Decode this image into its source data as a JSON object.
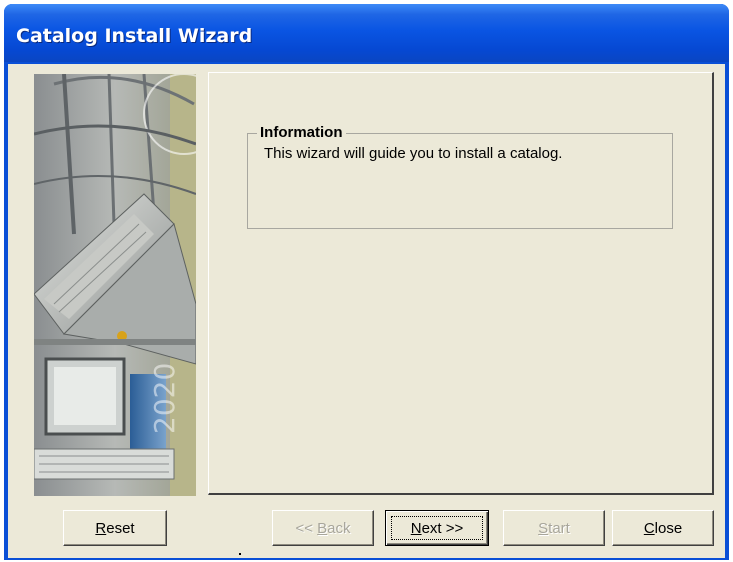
{
  "window": {
    "title": "Catalog Install Wizard"
  },
  "info_group": {
    "title": "Information",
    "text": "This wizard will guide you to install a catalog."
  },
  "buttons": {
    "reset": {
      "mnemonic": "R",
      "rest": "eset"
    },
    "back": {
      "prefix": "<< ",
      "mnemonic": "B",
      "rest": "ack"
    },
    "next": {
      "mnemonic": "N",
      "rest": "ext >>"
    },
    "start": {
      "mnemonic": "S",
      "rest": "tart"
    },
    "close": {
      "mnemonic": "C",
      "rest": "lose"
    }
  },
  "colors": {
    "titlebar": "#0a55e3",
    "dialog_face": "#ece9d8",
    "disabled_text": "#a8a69b"
  },
  "icons": {
    "side_art": "books-globe-computer-illustration"
  }
}
